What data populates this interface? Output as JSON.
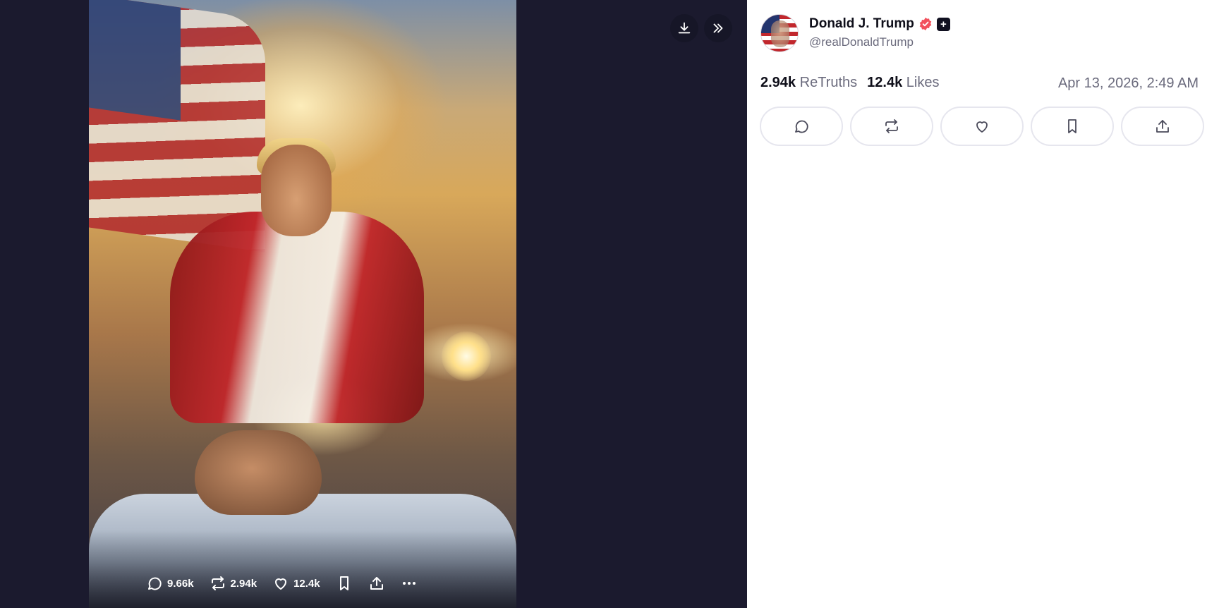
{
  "media": {
    "stats": {
      "replies": "9.66k",
      "retruths": "2.94k",
      "likes": "12.4k"
    },
    "icons": [
      "reply-icon",
      "retruth-icon",
      "like-icon",
      "bookmark-icon",
      "share-icon",
      "more-icon",
      "download-icon",
      "expand-icon"
    ]
  },
  "author": {
    "name": "Donald J. Trump",
    "handle": "@realDonaldTrump",
    "verified_color": "#f2505c"
  },
  "post": {
    "retruths_count": "2.94k",
    "retruths_label": "ReTruths",
    "likes_count": "12.4k",
    "likes_label": "Likes",
    "timestamp": "Apr 13, 2026, 2:49 AM"
  },
  "actions": [
    "reply-icon",
    "retruth-icon",
    "like-icon",
    "bookmark-icon",
    "share-icon"
  ],
  "colors": {
    "viewer_bg": "#1b1a2e",
    "text_primary": "#0f0f1a",
    "text_secondary": "#6b6b7d"
  }
}
